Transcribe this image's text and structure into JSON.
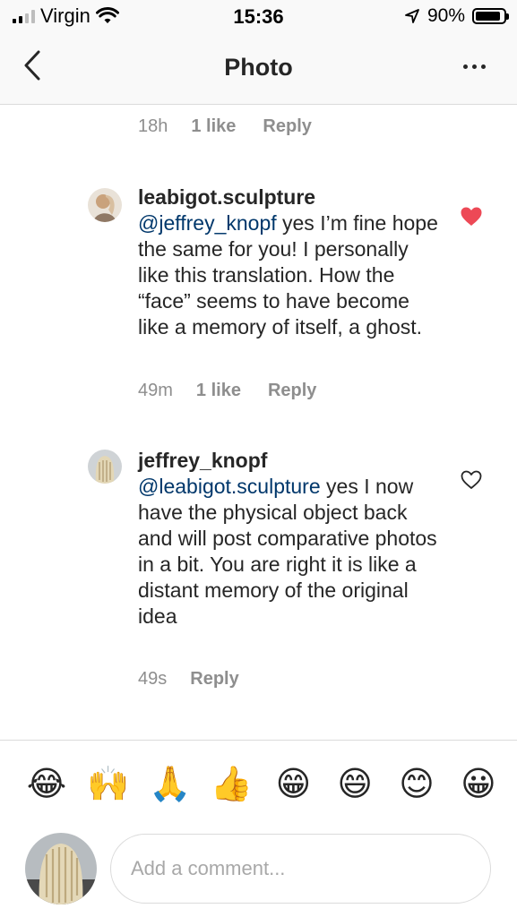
{
  "status_bar": {
    "carrier": "Virgin",
    "time": "15:36",
    "battery": "90%"
  },
  "nav": {
    "title": "Photo"
  },
  "previous_comment_meta": {
    "time": "18h",
    "likes": "1 like",
    "reply": "Reply"
  },
  "comments": [
    {
      "username": "leabigot.sculpture",
      "mention": "@jeffrey_knopf",
      "text": " yes I’m fine hope the same for you! I personally like this translation. How the “face” seems to have become like a memory of itself, a ghost.",
      "time": "49m",
      "likes": "1 like",
      "reply": "Reply",
      "liked": true,
      "heart_color": "#ed4956"
    },
    {
      "username": "jeffrey_knopf",
      "mention": "@leabigot.sculpture",
      "text": " yes I now have the physical object back and will post comparative photos in a bit. You are right it is like a distant memory of the original idea",
      "time": "49s",
      "reply": "Reply",
      "liked": false
    }
  ],
  "emoji_bar": [
    "😂",
    "🙌",
    "🙏",
    "👍",
    "😁",
    "😄",
    "😊",
    "😀"
  ],
  "composer": {
    "placeholder": "Add a comment..."
  }
}
